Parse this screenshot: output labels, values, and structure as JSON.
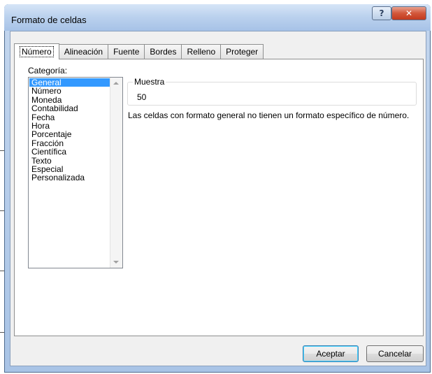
{
  "window": {
    "title": "Formato de celdas",
    "help_label": "?",
    "close_label": "✕"
  },
  "tabs": [
    {
      "label": "Número",
      "active": true
    },
    {
      "label": "Alineación"
    },
    {
      "label": "Fuente"
    },
    {
      "label": "Bordes"
    },
    {
      "label": "Relleno"
    },
    {
      "label": "Proteger"
    }
  ],
  "category": {
    "label": "Categoría:",
    "items": [
      "General",
      "Número",
      "Moneda",
      "Contabilidad",
      "Fecha",
      "Hora",
      "Porcentaje",
      "Fracción",
      "Científica",
      "Texto",
      "Especial",
      "Personalizada"
    ],
    "selected_index": 0
  },
  "sample": {
    "label": "Muestra",
    "value": "50"
  },
  "description": "Las celdas con formato general no tienen un formato específico de número.",
  "buttons": {
    "ok": "Aceptar",
    "cancel": "Cancelar"
  },
  "colors": {
    "selection": "#3399ff",
    "frame": "#a9c4e6",
    "close": "#c23a1e"
  }
}
